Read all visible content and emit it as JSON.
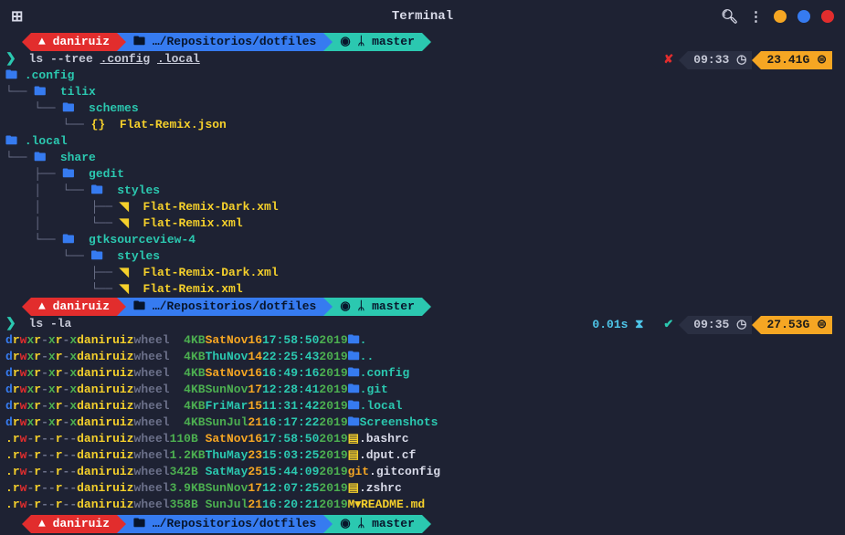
{
  "titlebar": {
    "title": "Terminal"
  },
  "prompt1": {
    "user": "daniruiz",
    "path": "…/Repositorios/dotfiles",
    "branch": "master",
    "command_prefix": "ls --tree ",
    "arg1": ".config",
    "arg2": ".local"
  },
  "status1": {
    "time": "09:33",
    "disk": "23.41G"
  },
  "tree": {
    "config": ".config",
    "tilix": "tilix",
    "schemes": "schemes",
    "flatremixjson": "Flat-Remix.json",
    "local": ".local",
    "share": "share",
    "gedit": "gedit",
    "styles1": "styles",
    "flatremixdarkxml1": "Flat-Remix-Dark.xml",
    "flatremixxml1": "Flat-Remix.xml",
    "gtksourceview": "gtksourceview-4",
    "styles2": "styles",
    "flatremixdarkxml2": "Flat-Remix-Dark.xml",
    "flatremixxml2": "Flat-Remix.xml"
  },
  "prompt2": {
    "user": "daniruiz",
    "path": "…/Repositorios/dotfiles",
    "branch": "master",
    "command": "ls -la"
  },
  "status2": {
    "duration": "0.01s",
    "time": "09:35",
    "disk": "27.53G"
  },
  "listing": [
    {
      "perm": "drwxr-xr-x",
      "user": "daniruiz",
      "group": "wheel",
      "size": "4",
      "unit": "KB",
      "date": "Sat Nov 16 17:58:50",
      "year": "2019",
      "icon": "folder",
      "name": ".",
      "weekday": "Sat",
      "month": "Nov",
      "day": "16",
      "time": "17:58:50",
      "dayColor": "orange"
    },
    {
      "perm": "drwxr-xr-x",
      "user": "daniruiz",
      "group": "wheel",
      "size": "4",
      "unit": "KB",
      "date": "Thu Nov 14 22:25:43",
      "year": "2019",
      "icon": "folder",
      "name": "..",
      "weekday": "Thu",
      "month": "Nov",
      "day": "14",
      "time": "22:25:43",
      "dayColor": "teal"
    },
    {
      "perm": "drwxr-xr-x",
      "user": "daniruiz",
      "group": "wheel",
      "size": "4",
      "unit": "KB",
      "date": "Sat Nov 16 16:49:16",
      "year": "2019",
      "icon": "folder",
      "name": ".config",
      "weekday": "Sat",
      "month": "Nov",
      "day": "16",
      "time": "16:49:16",
      "dayColor": "orange"
    },
    {
      "perm": "drwxr-xr-x",
      "user": "daniruiz",
      "group": "wheel",
      "size": "4",
      "unit": "KB",
      "date": "Sun Nov 17 12:28:41",
      "year": "2019",
      "icon": "folder",
      "name": ".git",
      "weekday": "Sun",
      "month": "Nov",
      "day": "17",
      "time": "12:28:41",
      "dayColor": "green"
    },
    {
      "perm": "drwxr-xr-x",
      "user": "daniruiz",
      "group": "wheel",
      "size": "4",
      "unit": "KB",
      "date": "Fri Mar 15 11:31:42",
      "year": "2019",
      "icon": "folder",
      "name": ".local",
      "weekday": "Fri",
      "month": "Mar",
      "day": "15",
      "time": "11:31:42",
      "dayColor": "teal"
    },
    {
      "perm": "drwxr-xr-x",
      "user": "daniruiz",
      "group": "wheel",
      "size": "4",
      "unit": "KB",
      "date": "Sun Jul 21 16:17:22",
      "year": "2019",
      "icon": "folder",
      "name": "Screenshots",
      "weekday": "Sun",
      "month": "Jul",
      "day": "21",
      "time": "16:17:22",
      "dayColor": "green"
    },
    {
      "perm": ".rw-r--r--",
      "user": "daniruiz",
      "group": "wheel",
      "size": "110",
      "unit": "B ",
      "date": "Sat Nov 16 17:58:50",
      "year": "2019",
      "icon": "file",
      "name": ".bashrc",
      "weekday": "Sat",
      "month": "Nov",
      "day": "16",
      "time": "17:58:50",
      "dayColor": "orange"
    },
    {
      "perm": ".rw-r--r--",
      "user": "daniruiz",
      "group": "wheel",
      "size": "1.2",
      "unit": "KB",
      "date": "Thu May 23 15:03:25",
      "year": "2019",
      "icon": "file",
      "name": ".dput.cf",
      "weekday": "Thu",
      "month": "May",
      "day": "23",
      "time": "15:03:25",
      "dayColor": "teal"
    },
    {
      "perm": ".rw-r--r--",
      "user": "daniruiz",
      "group": "wheel",
      "size": "342",
      "unit": "B ",
      "date": "Sat May 25 15:44:09",
      "year": "2019",
      "icon": "git",
      "name": ".gitconfig",
      "weekday": "Sat",
      "month": "May",
      "day": "25",
      "time": "15:44:09",
      "dayColor": "teal"
    },
    {
      "perm": ".rw-r--r--",
      "user": "daniruiz",
      "group": "wheel",
      "size": "3.9",
      "unit": "KB",
      "date": "Sun Nov 17 12:07:25",
      "year": "2019",
      "icon": "file",
      "name": ".zshrc",
      "weekday": "Sun",
      "month": "Nov",
      "day": "17",
      "time": "12:07:25",
      "dayColor": "green"
    },
    {
      "perm": ".rw-r--r--",
      "user": "daniruiz",
      "group": "wheel",
      "size": "358",
      "unit": "B ",
      "date": "Sun Jul 21 16:20:21",
      "year": "2019",
      "icon": "md",
      "name": "README.md",
      "weekday": "Sun",
      "month": "Jul",
      "day": "21",
      "time": "16:20:21",
      "dayColor": "green"
    }
  ],
  "prompt3": {
    "user": "daniruiz",
    "path": "…/Repositorios/dotfiles",
    "branch": "master"
  }
}
